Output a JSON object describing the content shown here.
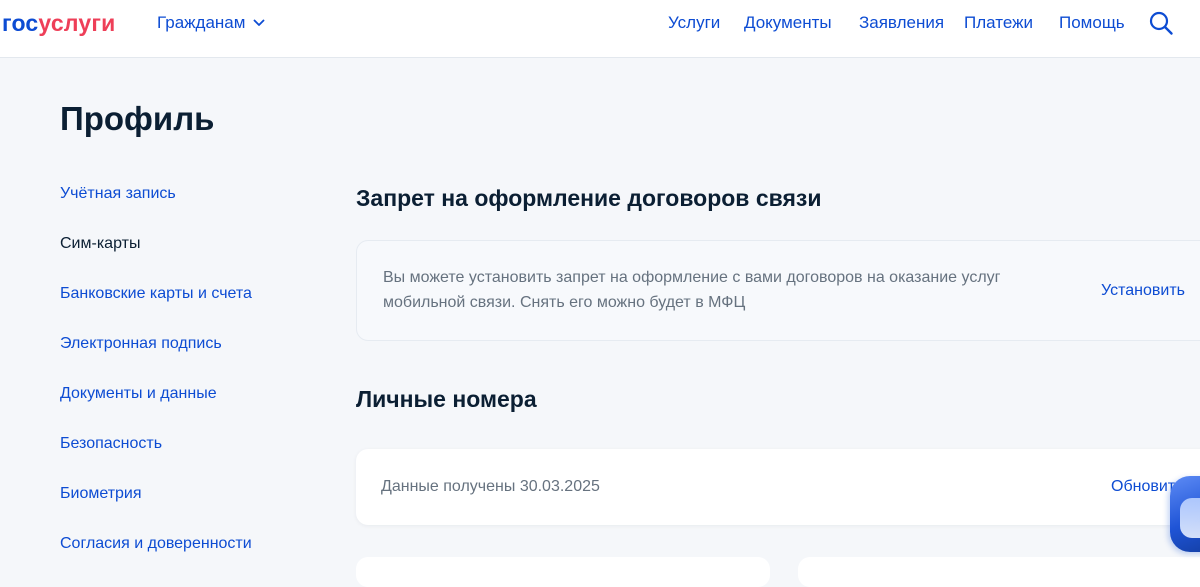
{
  "header": {
    "logo_part1": "гос",
    "logo_part2": "услуги",
    "audience": "Гражданам",
    "nav": [
      "Услуги",
      "Документы",
      "Заявления",
      "Платежи",
      "Помощь"
    ]
  },
  "page_title": "Профиль",
  "sidebar": {
    "items": [
      {
        "label": "Учётная запись",
        "active": false
      },
      {
        "label": "Сим-карты",
        "active": true
      },
      {
        "label": "Банковские карты и счета",
        "active": false
      },
      {
        "label": "Электронная подпись",
        "active": false
      },
      {
        "label": "Документы и данные",
        "active": false
      },
      {
        "label": "Безопасность",
        "active": false
      },
      {
        "label": "Биометрия",
        "active": false
      },
      {
        "label": "Согласия и доверенности",
        "active": false
      }
    ]
  },
  "ban_section": {
    "title": "Запрет на оформление договоров связи",
    "text": "Вы можете установить запрет на оформление с вами договоров на оказание услуг мобильной связи. Снять его можно будет в МФЦ",
    "action": "Установить"
  },
  "numbers_section": {
    "title": "Личные номера",
    "status": "Данные получены 30.03.2025",
    "action": "Обновить"
  },
  "icons": {
    "audience_chevron": "chevron-down-icon",
    "search": "search-icon"
  },
  "colors": {
    "brand_blue": "#0d4cd3",
    "brand_red": "#ee3f58",
    "text_dark": "#0b1f33",
    "text_muted": "#66727f",
    "page_bg": "#f5f7fa"
  }
}
